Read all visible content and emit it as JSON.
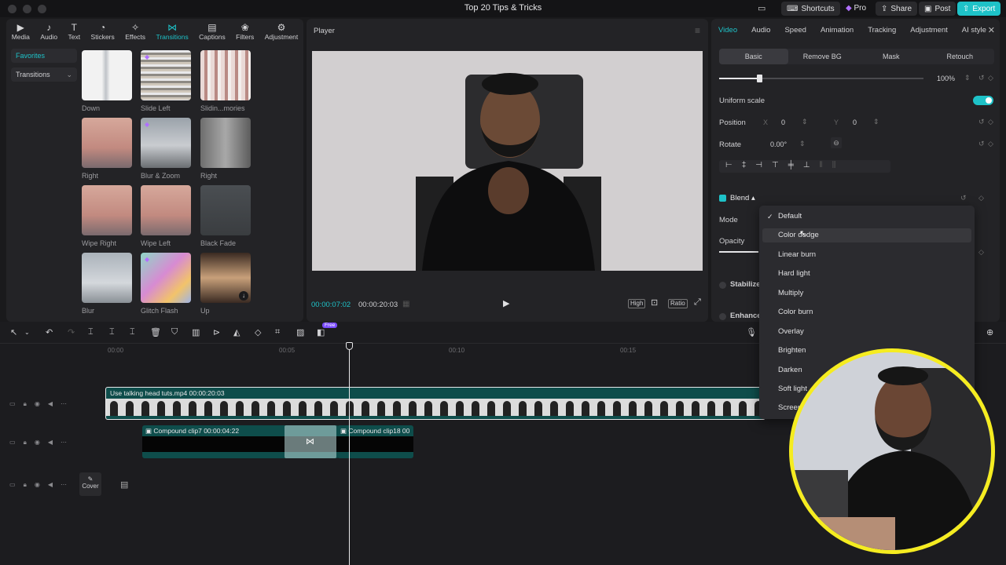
{
  "window": {
    "title": "Top 20 Tips & Tricks"
  },
  "top_buttons": {
    "shortcuts": "Shortcuts",
    "pro": "Pro",
    "share": "Share",
    "post": "Post",
    "export": "Export"
  },
  "categories": [
    "Media",
    "Audio",
    "Text",
    "Stickers",
    "Effects",
    "Transitions",
    "Captions",
    "Filters",
    "Adjustment"
  ],
  "active_category": "Transitions",
  "sidenav": {
    "favorites": "Favorites",
    "transitions": "Transitions"
  },
  "transitions": [
    {
      "label": "Down"
    },
    {
      "label": "Slide Left"
    },
    {
      "label": "Slidin...mories"
    },
    {
      "label": "Right"
    },
    {
      "label": "Blur & Zoom"
    },
    {
      "label": "Right"
    },
    {
      "label": "Wipe Right"
    },
    {
      "label": "Wipe Left"
    },
    {
      "label": "Black Fade"
    },
    {
      "label": "Blur"
    },
    {
      "label": "Glitch Flash"
    },
    {
      "label": "Up"
    }
  ],
  "player": {
    "title": "Player",
    "current_time": "00:00:07:02",
    "total_time": "00:00:20:03",
    "quality": "High",
    "ratio": "Ratio"
  },
  "props": {
    "tabs": [
      "Video",
      "Audio",
      "Speed",
      "Animation",
      "Tracking",
      "Adjustment",
      "AI style"
    ],
    "subtabs": [
      "Basic",
      "Remove BG",
      "Mask",
      "Retouch"
    ],
    "scale_value": "100%",
    "uniform_scale": "Uniform scale",
    "position_label": "Position",
    "x_label": "X",
    "x_value": "0",
    "y_label": "Y",
    "y_value": "0",
    "rotate_label": "Rotate",
    "rotate_value": "0.00°",
    "blend_label": "Blend",
    "mode_label": "Mode",
    "opacity_label": "Opacity",
    "stabilize_label": "Stabilize",
    "enhance_label": "Enhance"
  },
  "blend_modes": {
    "options": [
      "Default",
      "Color dodge",
      "Linear burn",
      "Hard light",
      "Multiply",
      "Color burn",
      "Overlay",
      "Brighten",
      "Darken",
      "Soft light",
      "Screen"
    ],
    "selected": "Default",
    "hovered": "Color dodge"
  },
  "timeline": {
    "ticks": [
      "00:00",
      "00:05",
      "00:10",
      "00:15"
    ],
    "main_clip": "Use talking head tuts.mp4   00:00:20:03",
    "clip_a": "Compound clip7   00:00:04:22",
    "clip_b": "Compound clip18   00",
    "cover": "Cover",
    "free_badge": "Free"
  },
  "colors": {
    "accent": "#1ec2c8",
    "webcam_ring": "#f5ec20",
    "clip": "#0e4d4b"
  }
}
